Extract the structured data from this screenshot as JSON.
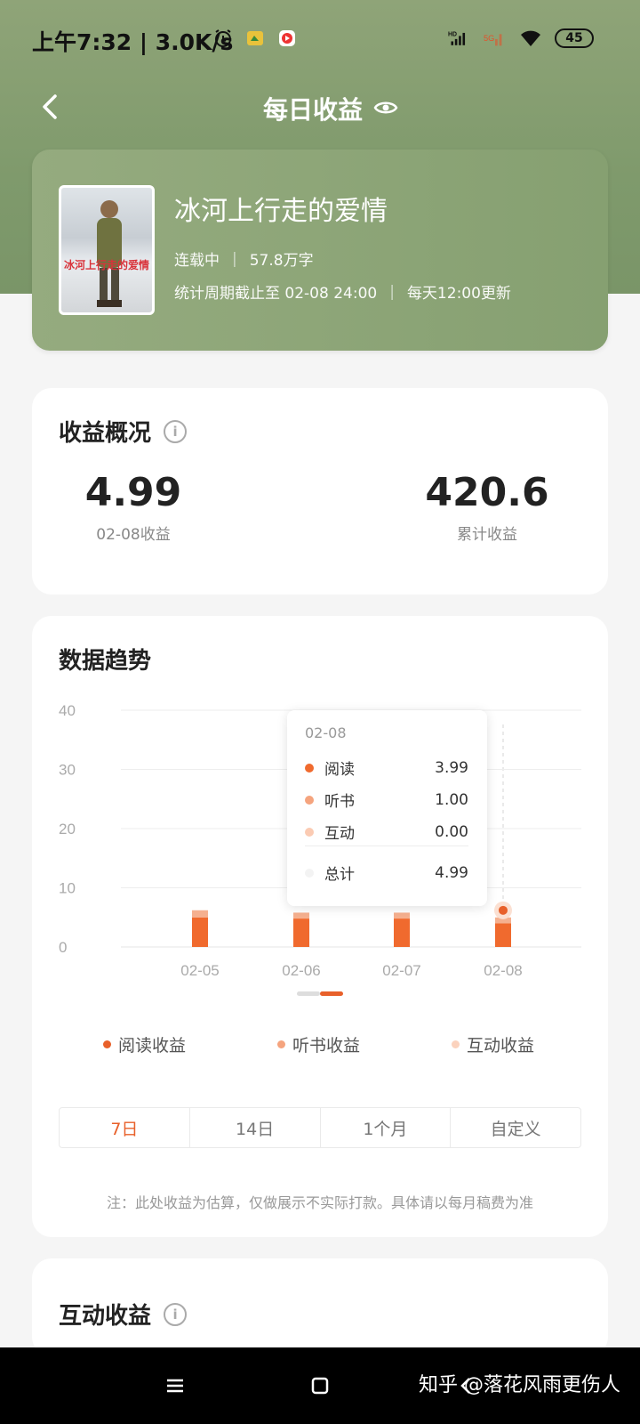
{
  "status_bar": {
    "time": "上午7:32 | 3.0K/s",
    "battery": "45"
  },
  "header": {
    "title": "每日收益"
  },
  "book": {
    "title": "冰河上行走的爱情",
    "cover_text": "冰河上行走的爱情",
    "status": "连载中",
    "word_count": "57.8万字",
    "stats_period": "统计周期截止至 02-08 24:00",
    "update_info": "每天12:00更新"
  },
  "overview": {
    "title": "收益概况",
    "daily_value": "4.99",
    "daily_label": "02-08收益",
    "total_value": "420.6",
    "total_label": "累计收益"
  },
  "trend": {
    "title": "数据趋势",
    "tooltip": {
      "date": "02-08",
      "rows": [
        {
          "label": "阅读",
          "value": "3.99"
        },
        {
          "label": "听书",
          "value": "1.00"
        },
        {
          "label": "互动",
          "value": "0.00"
        }
      ],
      "total_label": "总计",
      "total_value": "4.99"
    },
    "legend": [
      "阅读收益",
      "听书收益",
      "互动收益"
    ],
    "tabs": [
      "7日",
      "14日",
      "1个月",
      "自定义"
    ],
    "active_tab": "7日",
    "note": "注：此处收益为估算，仅做展示不实际打款。具体请以每月稿费为准"
  },
  "chart_data": {
    "type": "bar",
    "stacked": true,
    "categories": [
      "02-05",
      "02-06",
      "02-07",
      "02-08"
    ],
    "series": [
      {
        "name": "阅读收益",
        "values": [
          5.0,
          4.8,
          4.8,
          3.99
        ],
        "color": "#f06a2e"
      },
      {
        "name": "听书收益",
        "values": [
          1.2,
          1.0,
          1.0,
          1.0
        ],
        "color": "#f5b08f"
      },
      {
        "name": "互动收益",
        "values": [
          0,
          0,
          0,
          0.0
        ],
        "color": "#fbd8c6"
      }
    ],
    "y_ticks": [
      "0",
      "10",
      "20",
      "30",
      "40"
    ],
    "ylim": [
      0,
      40
    ],
    "grid": true
  },
  "interactive_section": {
    "title": "互动收益"
  },
  "watermark": "知乎 @落花风雨更伤人",
  "colors": {
    "accent": "#e8602a",
    "header_green": "#8fa478"
  }
}
